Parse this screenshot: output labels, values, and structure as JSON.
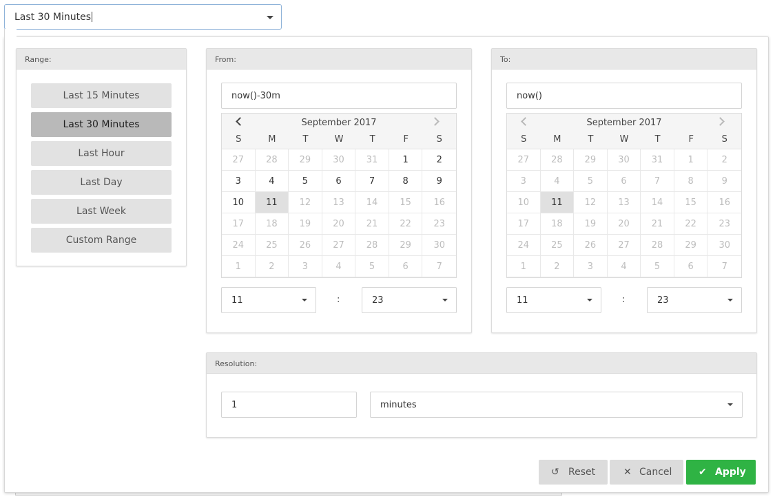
{
  "top_select": {
    "value": "Last 30 Minutes"
  },
  "range_panel": {
    "title": "Range:",
    "options": [
      "Last 15 Minutes",
      "Last 30 Minutes",
      "Last Hour",
      "Last Day",
      "Last Week",
      "Custom Range"
    ],
    "selected": "Last 30 Minutes"
  },
  "from_panel": {
    "title": "From:",
    "input": "now()-30m",
    "calendar": {
      "month_label": "September 2017",
      "weekdays": [
        "S",
        "M",
        "T",
        "W",
        "T",
        "F",
        "S"
      ],
      "days": [
        27,
        28,
        29,
        30,
        31,
        1,
        2,
        3,
        4,
        5,
        6,
        7,
        8,
        9,
        10,
        11,
        12,
        13,
        14,
        15,
        16,
        17,
        18,
        19,
        20,
        21,
        22,
        23,
        24,
        25,
        26,
        27,
        28,
        29,
        30,
        1,
        2,
        3,
        4,
        5,
        6,
        7
      ],
      "enabled_range": [
        5,
        15
      ],
      "selected_index": 15,
      "prev_enabled": true,
      "next_enabled": false
    },
    "hour": "11",
    "separator": ":",
    "minute": "23"
  },
  "to_panel": {
    "title": "To:",
    "input": "now()",
    "calendar": {
      "month_label": "September 2017",
      "weekdays": [
        "S",
        "M",
        "T",
        "W",
        "T",
        "F",
        "S"
      ],
      "days": [
        27,
        28,
        29,
        30,
        31,
        1,
        2,
        3,
        4,
        5,
        6,
        7,
        8,
        9,
        10,
        11,
        12,
        13,
        14,
        15,
        16,
        17,
        18,
        19,
        20,
        21,
        22,
        23,
        24,
        25,
        26,
        27,
        28,
        29,
        30,
        1,
        2,
        3,
        4,
        5,
        6,
        7
      ],
      "enabled_range": [
        15,
        15
      ],
      "selected_index": 15,
      "prev_enabled": false,
      "next_enabled": false
    },
    "hour": "11",
    "separator": ":",
    "minute": "23"
  },
  "resolution_panel": {
    "title": "Resolution:",
    "value": "1",
    "unit": "minutes"
  },
  "actions": {
    "reset_label": "Reset",
    "cancel_label": "Cancel",
    "apply_label": "Apply",
    "reset_icon": "undo-icon",
    "cancel_icon": "close-icon",
    "apply_icon": "check-icon",
    "apply_color": "#2fb344"
  }
}
